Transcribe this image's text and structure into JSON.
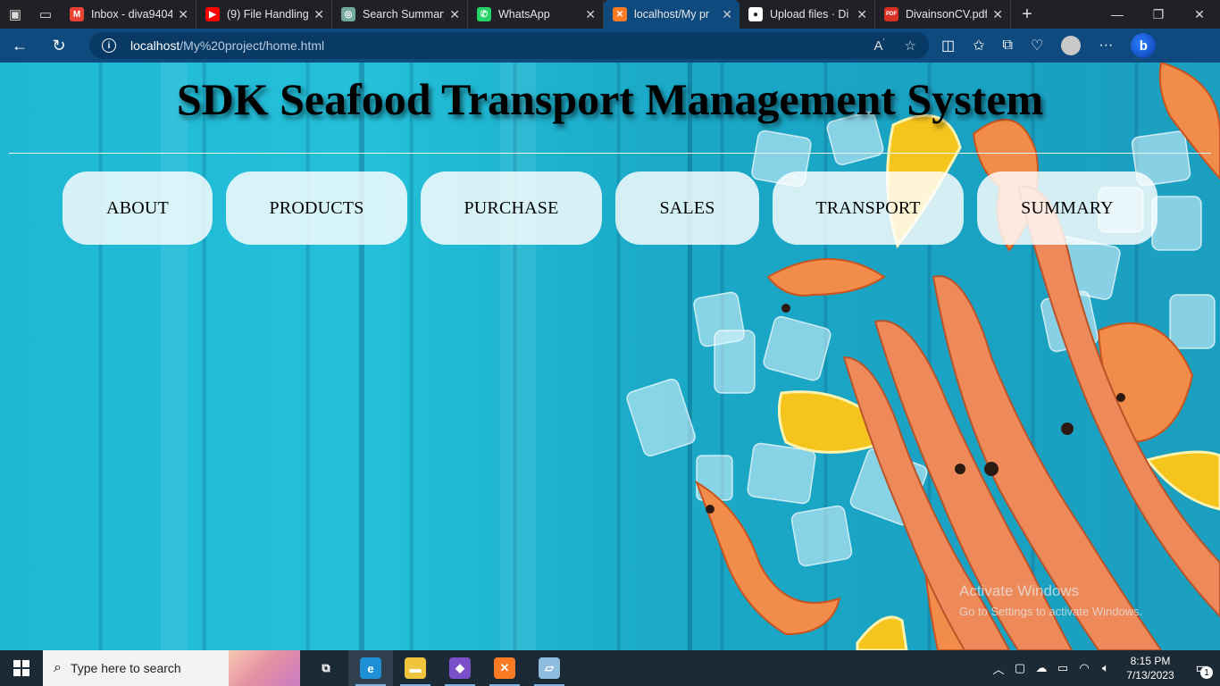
{
  "browser": {
    "tabs": [
      {
        "label": "Inbox - diva9404",
        "favicon": "gmail-icon",
        "favicon_color": "#ea4335",
        "favicon_glyph": "M",
        "active": false
      },
      {
        "label": "(9) File Handling",
        "favicon": "youtube-icon",
        "favicon_color": "#ff0000",
        "favicon_glyph": "▶",
        "active": false
      },
      {
        "label": "Search Summary",
        "favicon": "chatgpt-icon",
        "favicon_color": "#74aa9c",
        "favicon_glyph": "◎",
        "active": false
      },
      {
        "label": "WhatsApp",
        "favicon": "whatsapp-icon",
        "favicon_color": "#25d366",
        "favicon_glyph": "✆",
        "active": false
      },
      {
        "label": "localhost/My pr",
        "favicon": "xampp-icon",
        "favicon_color": "#fb7a24",
        "favicon_glyph": "✕",
        "active": true
      },
      {
        "label": "Upload files · Di",
        "favicon": "github-icon",
        "favicon_color": "#ffffff",
        "favicon_glyph": "●",
        "active": false
      },
      {
        "label": "DivainsonCV.pdf",
        "favicon": "pdf-icon",
        "favicon_color": "#d93025",
        "favicon_glyph": "PDF",
        "active": false
      }
    ],
    "address": {
      "host": "localhost",
      "path": "/My%20project/home.html"
    }
  },
  "page": {
    "title": "SDK Seafood Transport Management System",
    "menu": [
      {
        "label": "ABOUT"
      },
      {
        "label": "PRODUCTS"
      },
      {
        "label": "PURCHASE"
      },
      {
        "label": "SALES"
      },
      {
        "label": "TRANSPORT"
      },
      {
        "label": "SUMMARY"
      }
    ]
  },
  "watermark": {
    "line1": "Activate Windows",
    "line2": "Go to Settings to activate Windows."
  },
  "taskbar": {
    "search_placeholder": "Type here to search",
    "apps": [
      {
        "name": "task-view-icon",
        "glyph": "⧉",
        "color": "transparent"
      },
      {
        "name": "edge-icon",
        "glyph": "e",
        "color": "#1f8fd6"
      },
      {
        "name": "file-explorer-icon",
        "glyph": "▬",
        "color": "#f0c43c"
      },
      {
        "name": "visual-studio-icon",
        "glyph": "◆",
        "color": "#7a4fc9"
      },
      {
        "name": "xampp-icon",
        "glyph": "✕",
        "color": "#fb7a24"
      },
      {
        "name": "notepad-icon",
        "glyph": "▱",
        "color": "#8fbde0"
      }
    ],
    "time": "8:15 PM",
    "date": "7/13/2023",
    "notification_count": "1"
  }
}
